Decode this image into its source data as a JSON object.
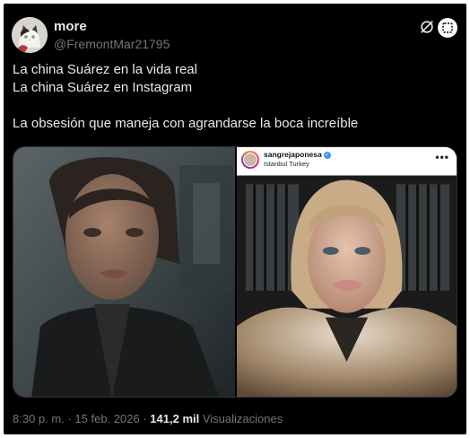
{
  "author": {
    "display_name": "more",
    "handle": "@FremontMar21795"
  },
  "tweet": {
    "lines": [
      "La china Suárez en la vida real",
      "La china Suárez en Instagram",
      "",
      "La obsesión que maneja con agrandarse la boca increíble"
    ]
  },
  "instagram_post": {
    "username": "sangrejaponesa",
    "location": "Istanbul Turkey",
    "more": "•••"
  },
  "footer": {
    "time": "8:30 p. m.",
    "separator": "·",
    "date": "15 feb. 2026",
    "views_count": "141,2 mil",
    "views_label": "Visualizaciones"
  },
  "icons": [
    "avatar-cat-icon",
    "grok-icon",
    "overlay-toggle-icon",
    "verified-badge-icon",
    "more-dots-icon"
  ]
}
